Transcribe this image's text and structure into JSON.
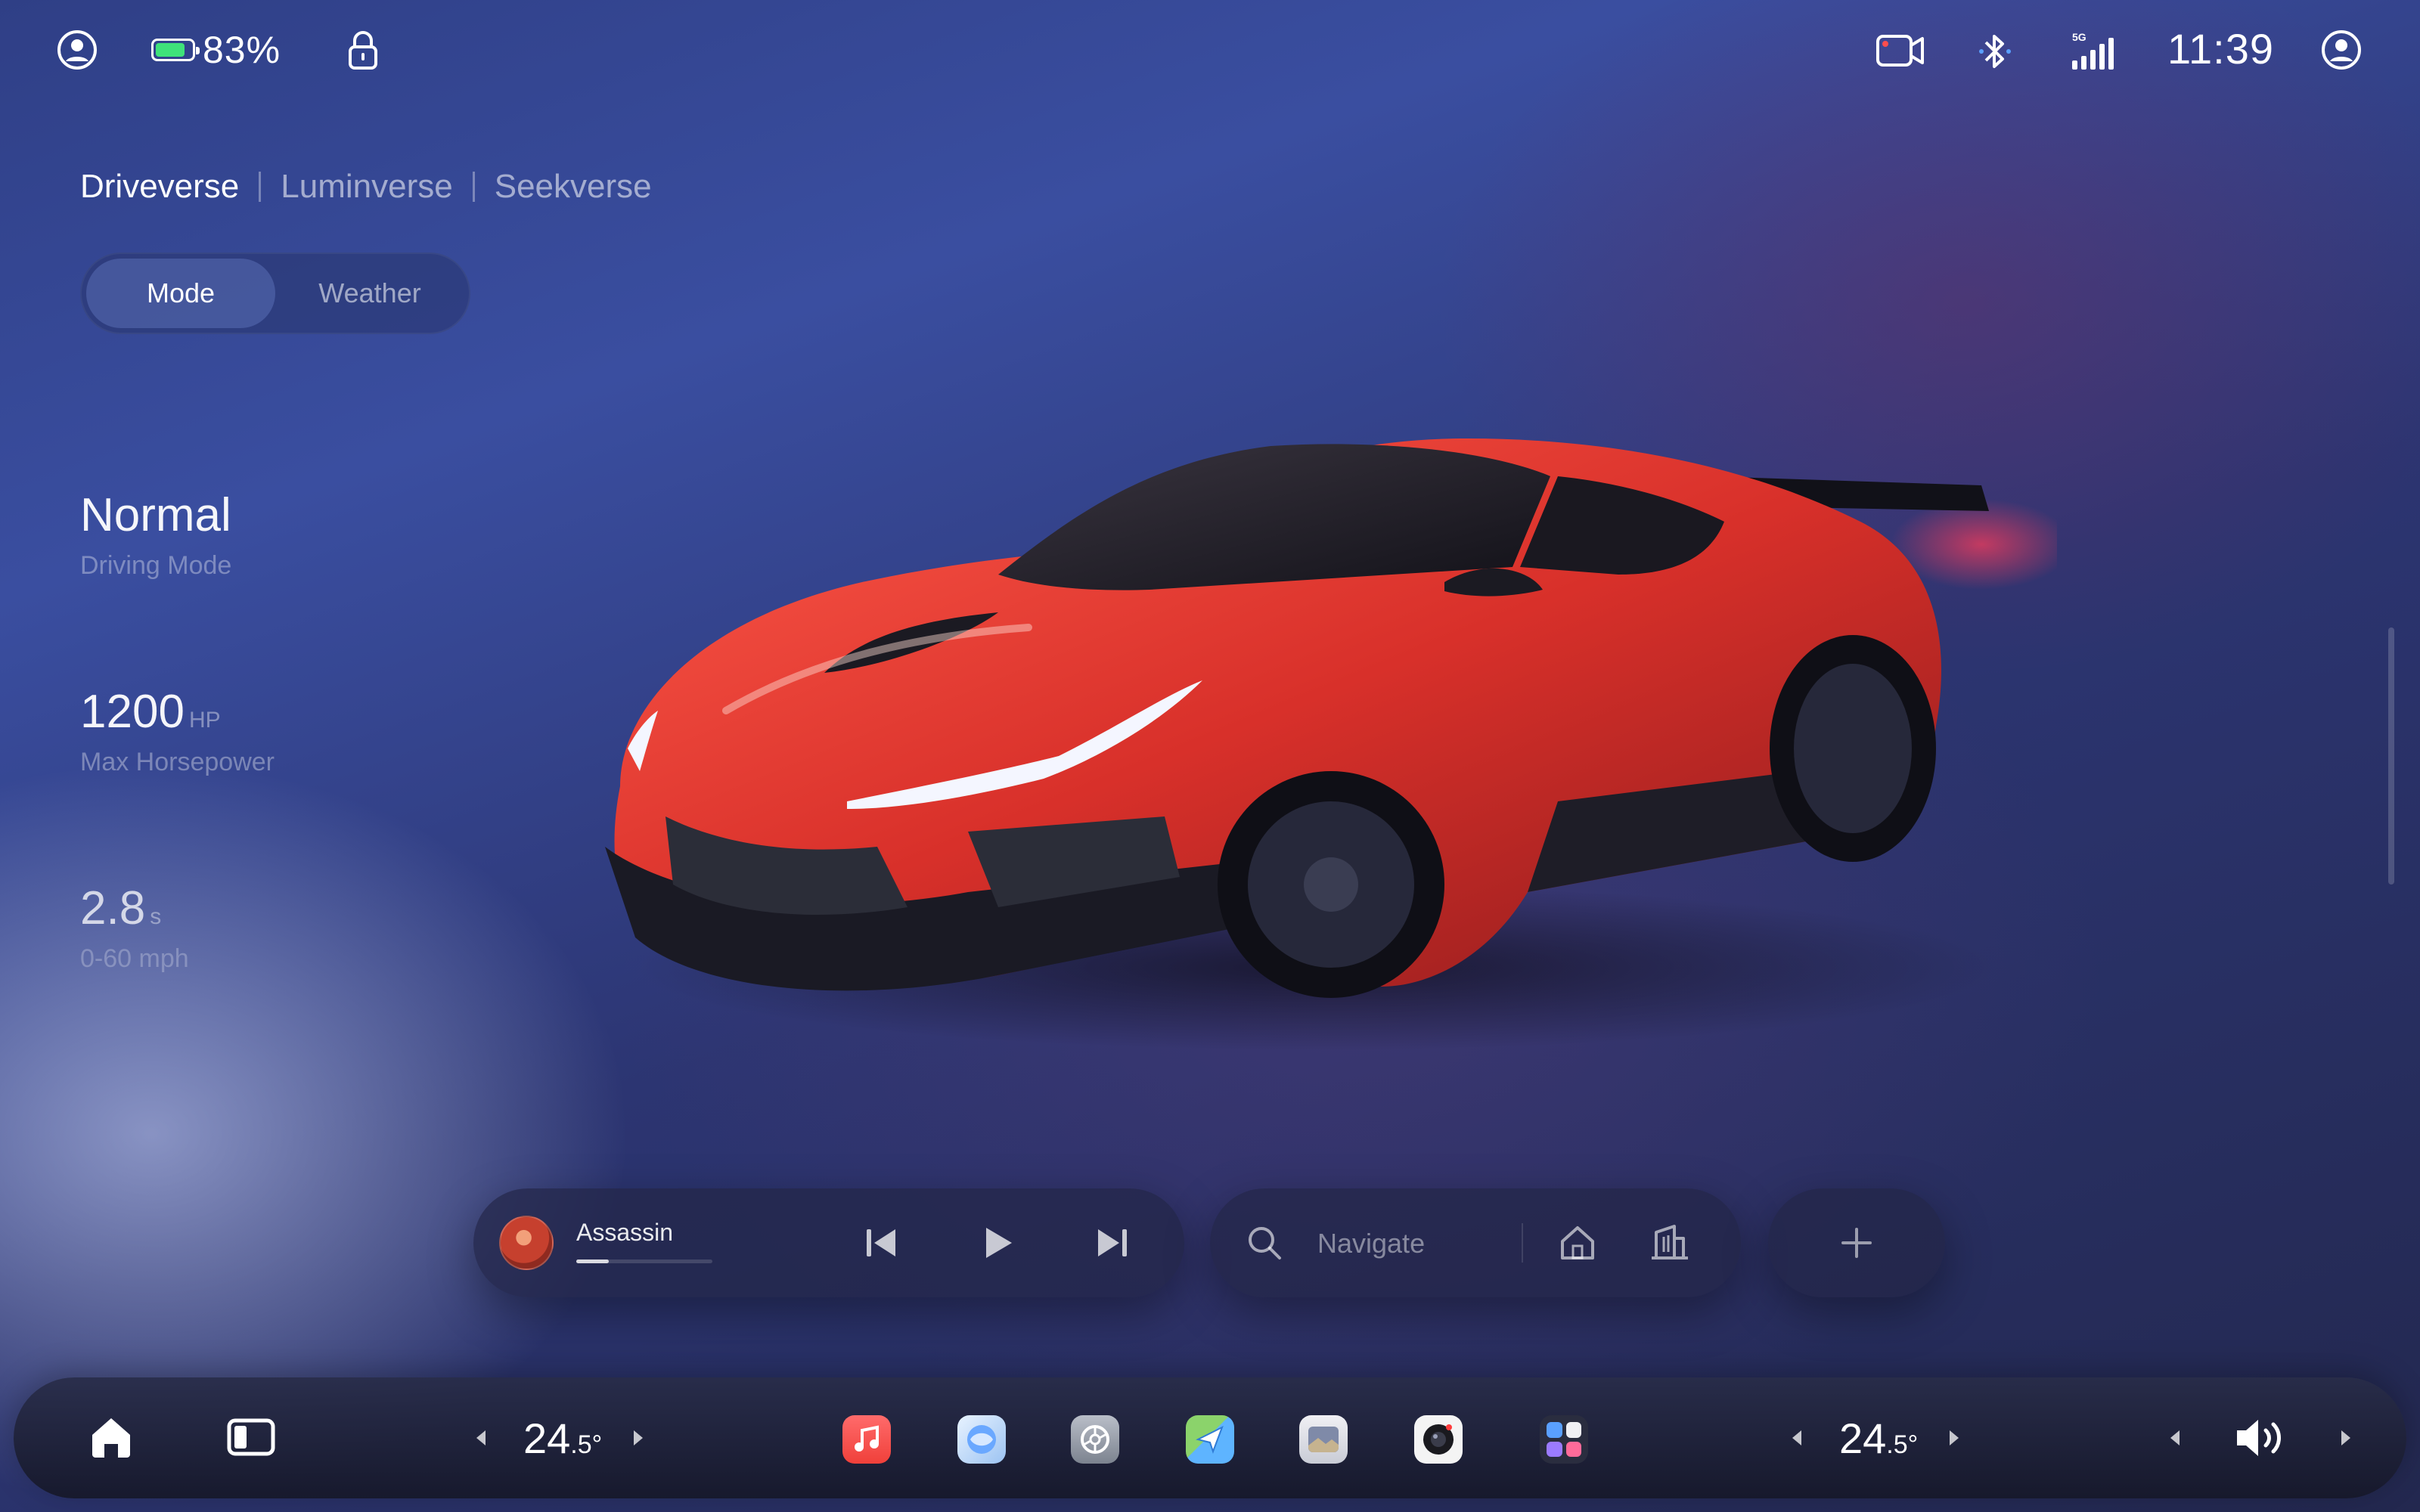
{
  "status": {
    "battery_percent": "83%",
    "battery_level": 0.83,
    "time": "11:39",
    "signal_label": "5G",
    "colors": {
      "battery": "#3fe27a"
    }
  },
  "tabs": [
    {
      "label": "Driveverse",
      "active": true
    },
    {
      "label": "Luminverse",
      "active": false
    },
    {
      "label": "Seekverse",
      "active": false
    }
  ],
  "segmented": [
    {
      "label": "Mode",
      "active": true
    },
    {
      "label": "Weather",
      "active": false
    }
  ],
  "stats": [
    {
      "value": "Normal",
      "unit": "",
      "label": "Driving Mode"
    },
    {
      "value": "1200",
      "unit": "HP",
      "label": "Max Horsepower"
    },
    {
      "value": "2.8",
      "unit": "s",
      "label": "0-60 mph"
    }
  ],
  "music": {
    "track": "Assassin",
    "progress": 0.24
  },
  "navigate": {
    "placeholder": "Navigate"
  },
  "dock": {
    "temp_left": {
      "main": "24",
      "decimal": ".5°"
    },
    "temp_right": {
      "main": "24",
      "decimal": ".5°"
    },
    "apps": [
      "music-app-icon",
      "siri-app-icon",
      "settings-app-icon",
      "maps-app-icon",
      "gallery-app-icon",
      "camera-app-icon",
      "app-grid-icon"
    ]
  }
}
